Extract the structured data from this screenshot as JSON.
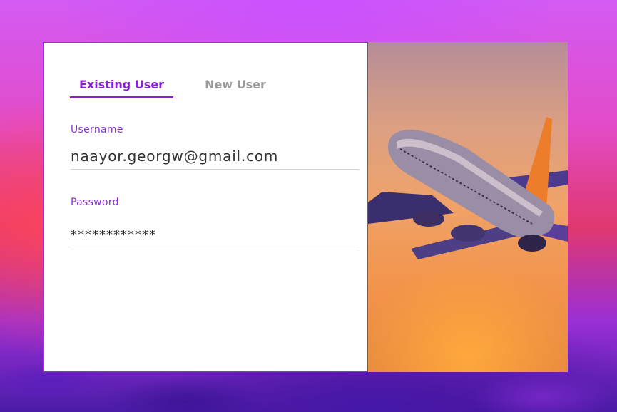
{
  "tabs": [
    {
      "label": "Existing User",
      "active": true
    },
    {
      "label": "New User",
      "active": false
    }
  ],
  "form": {
    "username": {
      "label": "Username",
      "value": "naayor.georgw@gmail.com"
    },
    "password": {
      "label": "Password",
      "value": "************"
    }
  },
  "colors": {
    "accent": "#8a1fd8",
    "inactive_tab": "#9a9a9a",
    "panel_border": "#9c2ee0"
  },
  "icons": {
    "hero": "airplane-photo"
  }
}
